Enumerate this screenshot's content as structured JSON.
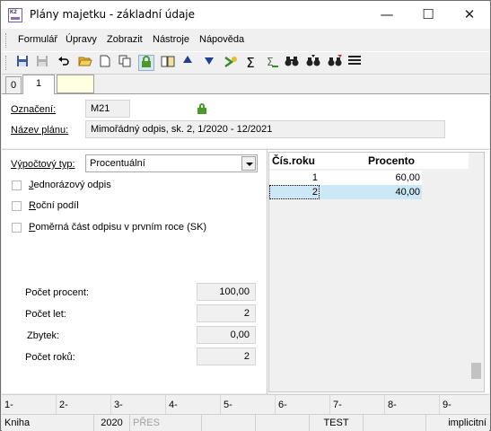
{
  "window": {
    "title": "Plány majetku - základní údaje",
    "app_icon_text": "K2",
    "minimize_glyph": "—",
    "maximize_glyph": "☐",
    "close_glyph": "✕"
  },
  "menu": [
    "Formulář",
    "Úpravy",
    "Zobrazit",
    "Nástroje",
    "Nápověda"
  ],
  "toolbar_icons": [
    "save-icon",
    "save-disabled-icon",
    "undo-icon",
    "open-folder-icon",
    "new-document-icon",
    "copy-icon",
    "lock-icon",
    "book-icon",
    "arrow-up-icon",
    "arrow-down-icon",
    "run-icon",
    "sum-icon",
    "sum-disabled-icon",
    "binoculars-icon",
    "binoculars-next-icon",
    "binoculars-filter-icon",
    "list-icon"
  ],
  "tabs": [
    "0",
    "1"
  ],
  "form": {
    "oznaceni_label": "Označení:",
    "oznaceni_value": "M21",
    "nazev_label": "Název plánu:",
    "nazev_value": "Mimořádný odpis, sk. 2, 1/2020 - 12/2021",
    "typ_label": "Výpočtový typ:",
    "typ_value": "Procentuální",
    "checkboxes": [
      {
        "label": "Jednorázový odpis",
        "checked": false
      },
      {
        "label": "Roční podíl",
        "checked": false
      },
      {
        "label": "Poměrná část odpisu v prvním roce (SK)",
        "checked": false
      }
    ],
    "pocet_procent_label": "Počet procent:",
    "pocet_procent_value": "100,00",
    "pocet_let_label": "Počet let:",
    "pocet_let_value": "2",
    "zbytek_label": "Zbytek:",
    "zbytek_value": "0,00",
    "pocet_roku_label": "Počet roků:",
    "pocet_roku_value": "2"
  },
  "grid": {
    "headers": [
      "Čís.roku",
      "Procento"
    ],
    "rows": [
      {
        "year": "1",
        "percent": "60,00"
      },
      {
        "year": "2",
        "percent": "40,00"
      }
    ]
  },
  "fkeys": [
    "1-",
    "2-",
    "3-",
    "4-",
    "5-",
    "6-",
    "7-",
    "8-",
    "9-"
  ],
  "status": {
    "kniha": "Kniha",
    "year": "2020",
    "pres": "PŘES",
    "test": "TEST",
    "implicitni": "implicitní"
  },
  "colors": {
    "selection": "#cce8f6",
    "lock_green": "#4a9a2a",
    "tab_yellow": "#ffffe1"
  }
}
